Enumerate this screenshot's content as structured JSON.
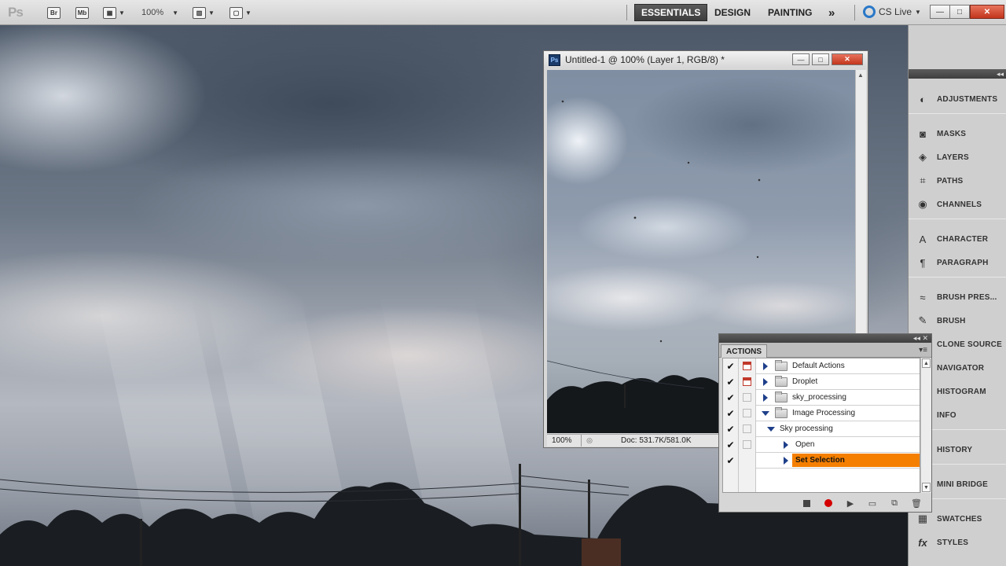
{
  "app": {
    "logo": "Ps",
    "bridge_label": "Br",
    "minibridge_label": "Mb",
    "zoom_value": "100%",
    "workspaces": [
      "ESSENTIALS",
      "DESIGN",
      "PAINTING"
    ],
    "workspace_overflow": "»",
    "cs_live": "CS Live",
    "window_controls": {
      "minimize": "—",
      "restore": "□",
      "close": "✕"
    }
  },
  "document": {
    "title": "Untitled-1 @ 100% (Layer 1, RGB/8) *",
    "zoom": "100%",
    "doc_info": "Doc: 531.7K/581.0K"
  },
  "dock": {
    "collapse_glyph": "◂◂",
    "items": [
      {
        "label": "ADJUSTMENTS",
        "icon": "adjustments-icon",
        "glyph": "◐"
      },
      {
        "label": "MASKS",
        "icon": "masks-icon",
        "glyph": "◙"
      },
      {
        "label": "LAYERS",
        "icon": "layers-icon",
        "glyph": "◈"
      },
      {
        "label": "PATHS",
        "icon": "paths-icon",
        "glyph": "⌗"
      },
      {
        "label": "CHANNELS",
        "icon": "channels-icon",
        "glyph": "◉"
      },
      {
        "label": "CHARACTER",
        "icon": "character-icon",
        "glyph": "A"
      },
      {
        "label": "PARAGRAPH",
        "icon": "paragraph-icon",
        "glyph": "¶"
      },
      {
        "label": "BRUSH PRES...",
        "icon": "brush-presets-icon",
        "glyph": "≈"
      },
      {
        "label": "BRUSH",
        "icon": "brush-icon",
        "glyph": "✎"
      },
      {
        "label": "CLONE SOURCE",
        "icon": "clone-source-icon",
        "glyph": "⊕"
      },
      {
        "label": "NAVIGATOR",
        "icon": "navigator-icon",
        "glyph": "⊡"
      },
      {
        "label": "HISTOGRAM",
        "icon": "histogram-icon",
        "glyph": "▥"
      },
      {
        "label": "INFO",
        "icon": "info-icon",
        "glyph": "ⓘ"
      },
      {
        "label": "HISTORY",
        "icon": "history-icon",
        "glyph": "◷"
      },
      {
        "label": "MINI BRIDGE",
        "icon": "mini-bridge-icon",
        "glyph": "▣"
      },
      {
        "label": "SWATCHES",
        "icon": "swatches-icon",
        "glyph": "▦"
      },
      {
        "label": "STYLES",
        "icon": "styles-icon",
        "glyph": "fx"
      }
    ]
  },
  "actions_panel": {
    "tab": "ACTIONS",
    "collapse_glyph": "◂◂ ✕",
    "rows": [
      {
        "label": "Default Actions",
        "checked": true,
        "dialog": true,
        "expand": "collapsed",
        "folder": true,
        "level": 0
      },
      {
        "label": "Droplet",
        "checked": true,
        "dialog": true,
        "expand": "collapsed",
        "folder": true,
        "level": 0
      },
      {
        "label": "sky_processing",
        "checked": true,
        "dialog": false,
        "expand": "collapsed",
        "folder": true,
        "level": 0
      },
      {
        "label": "Image Processing",
        "checked": true,
        "dialog": false,
        "expand": "expanded",
        "folder": true,
        "level": 0
      },
      {
        "label": "Sky processing",
        "checked": true,
        "dialog": false,
        "expand": "expanded",
        "folder": false,
        "level": 1
      },
      {
        "label": "Open",
        "checked": true,
        "dialog": false,
        "expand": "collapsed",
        "folder": false,
        "level": 2
      },
      {
        "label": "Set Selection",
        "checked": true,
        "dialog": false,
        "expand": "collapsed",
        "folder": false,
        "level": 2,
        "selected": true
      }
    ],
    "colors": {
      "selection": "#f57f00",
      "record": "#d40000"
    }
  }
}
